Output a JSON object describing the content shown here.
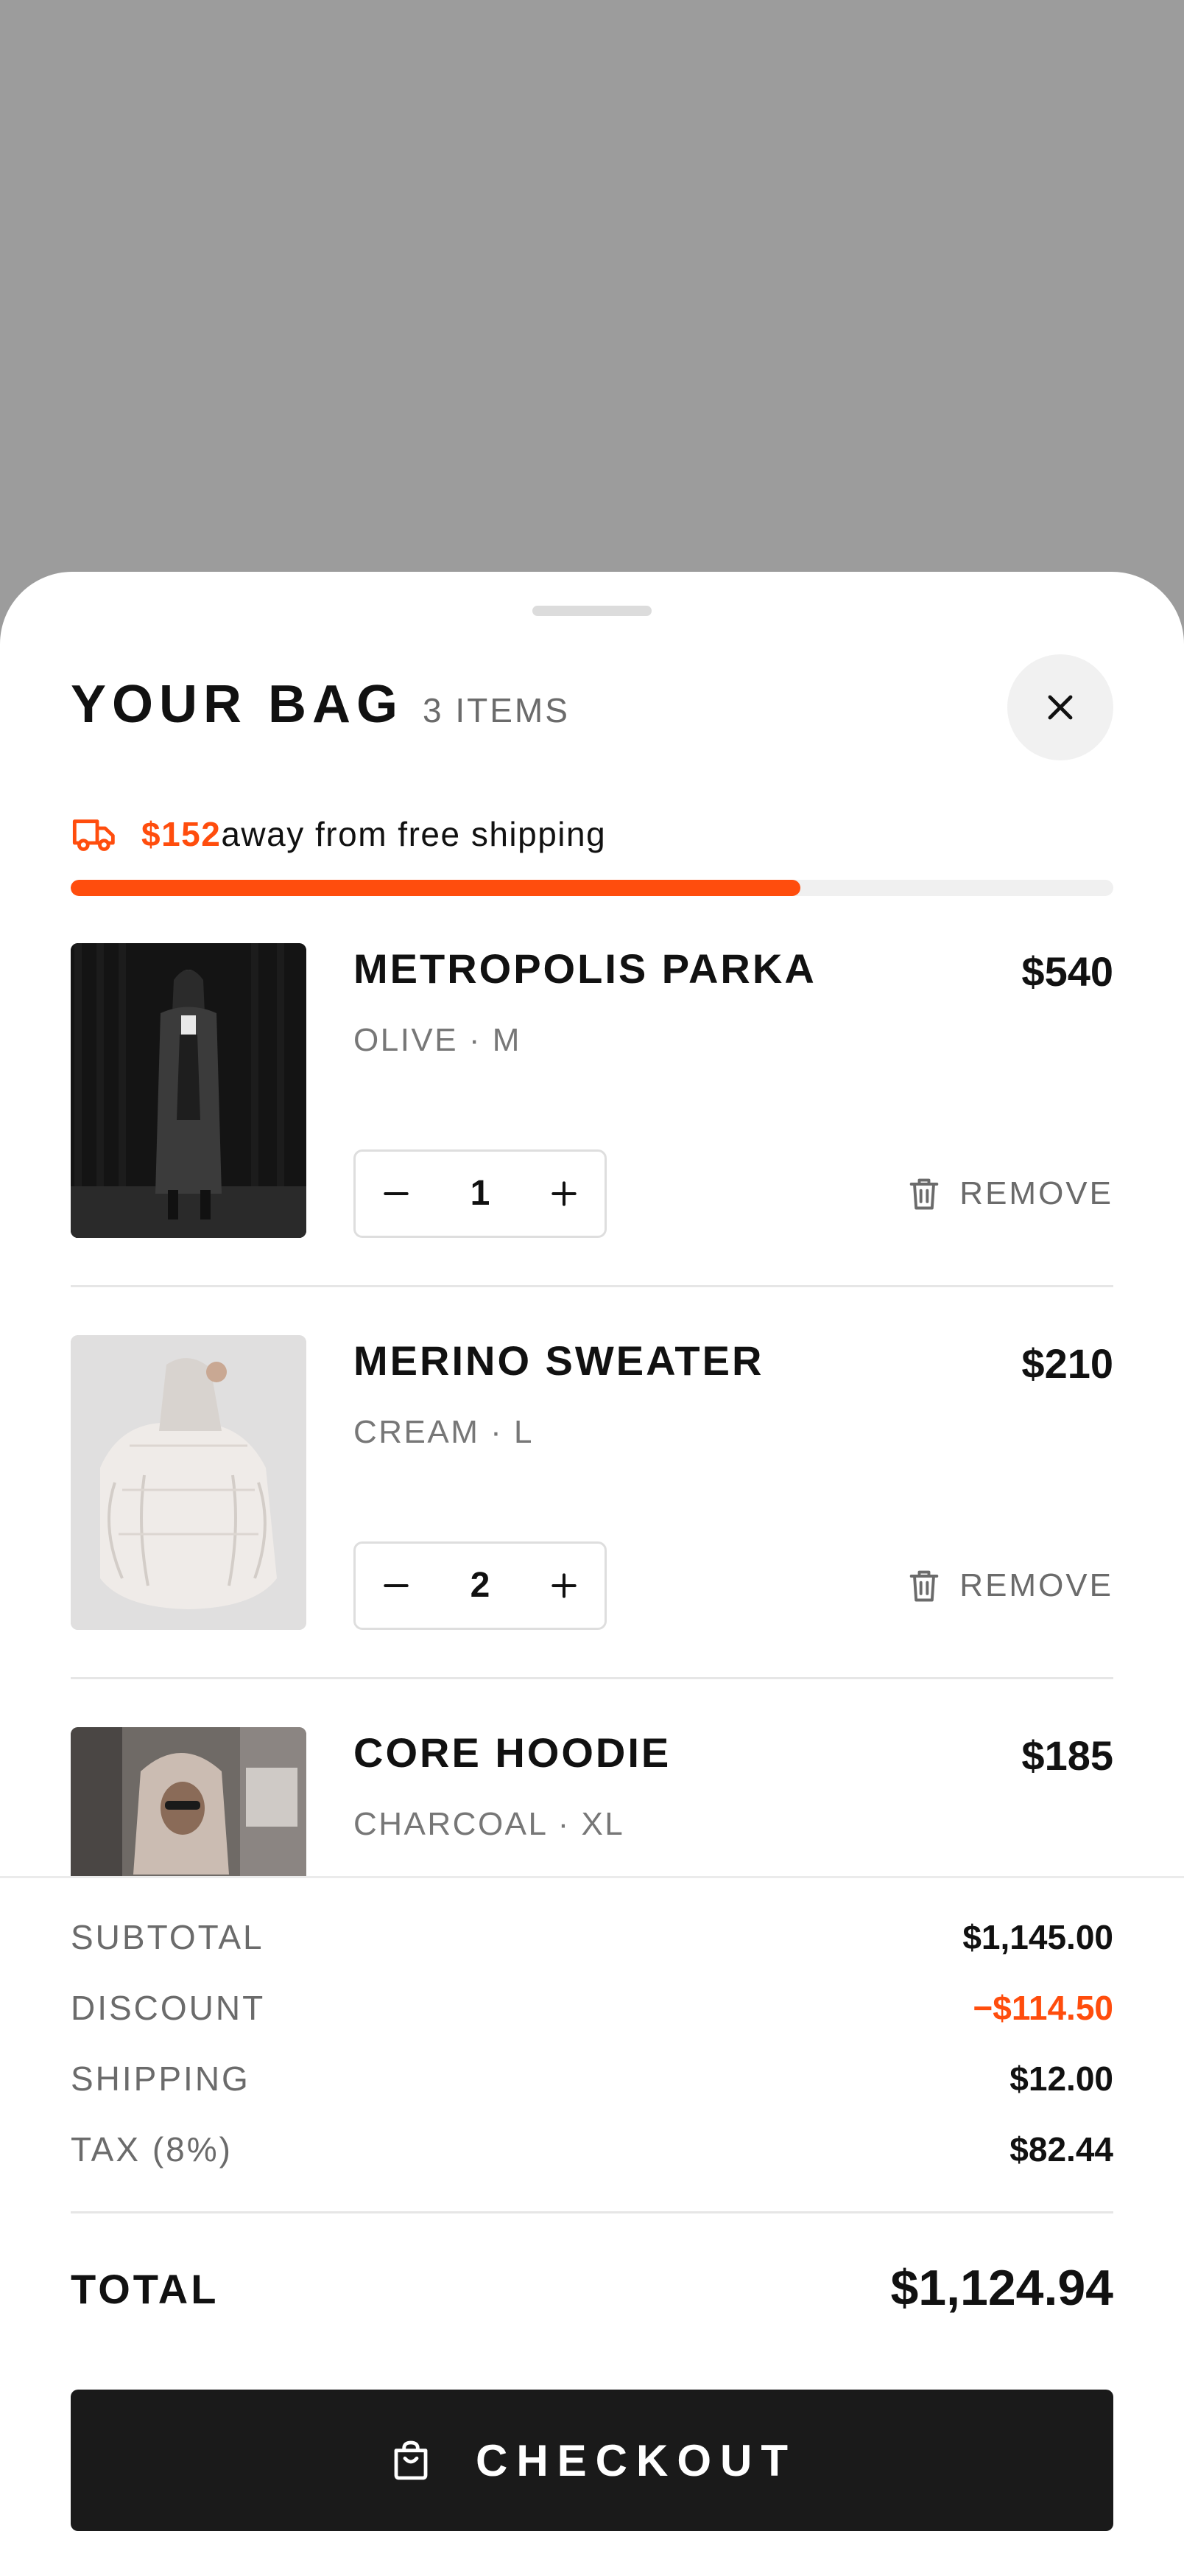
{
  "header": {
    "title": "YOUR BAG",
    "count": "3 ITEMS"
  },
  "shipping": {
    "amount": "$152",
    "message": "away from free shipping",
    "progress_fraction": 0.7,
    "accent_color": "#ff4d0d"
  },
  "items": [
    {
      "name": "METROPOLIS PARKA",
      "price": "$540",
      "variant": "OLIVE · M",
      "quantity": "1",
      "remove_label": "REMOVE"
    },
    {
      "name": "MERINO SWEATER",
      "price": "$210",
      "variant": "CREAM · L",
      "quantity": "2",
      "remove_label": "REMOVE"
    },
    {
      "name": "CORE HOODIE",
      "price": "$185",
      "variant": "CHARCOAL · XL",
      "quantity": "",
      "remove_label": ""
    }
  ],
  "summary": {
    "subtotal_label": "SUBTOTAL",
    "subtotal_value": "$1,145.00",
    "discount_label": "DISCOUNT",
    "discount_value": "−$114.50",
    "shipping_label": "SHIPPING",
    "shipping_value": "$12.00",
    "tax_label": "TAX (8%)",
    "tax_value": "$82.44",
    "total_label": "TOTAL",
    "total_value": "$1,124.94"
  },
  "checkout": {
    "label": "CHECKOUT"
  },
  "icons": {
    "close": "close-icon",
    "shipping": "truck-icon",
    "remove": "trash-icon",
    "minus": "minus-icon",
    "plus": "plus-icon",
    "checkout": "shopping-bag-icon"
  }
}
